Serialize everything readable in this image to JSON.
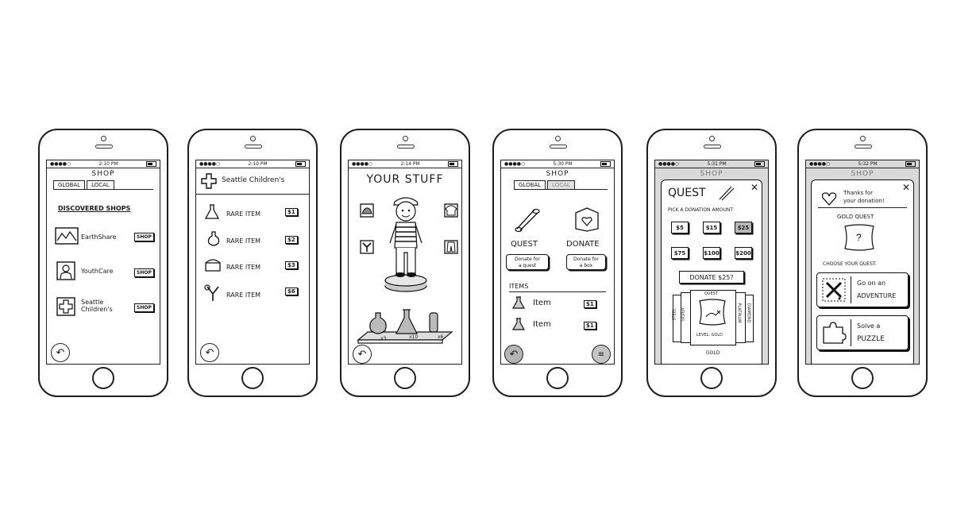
{
  "phone1": {
    "time": "2:10 PM",
    "title": "SHOP",
    "tabs": [
      "GLOBAL",
      "LOCAL"
    ],
    "section": "DISCOVERED SHOPS",
    "shops": [
      {
        "name": "EarthShare",
        "icon": "mountain-icon"
      },
      {
        "name": "YouthCare",
        "icon": "person-icon"
      },
      {
        "name": "Seattle Children's",
        "icon": "cross-icon"
      }
    ],
    "shop_label": "SHOP"
  },
  "phone2": {
    "time": "2:10 PM",
    "title": "Seattle Children's",
    "items": [
      {
        "label": "RARE ITEM",
        "price": "$1",
        "icon": "flask-icon"
      },
      {
        "label": "RARE ITEM",
        "price": "$2",
        "icon": "potion-icon"
      },
      {
        "label": "RARE ITEM",
        "price": "$3",
        "icon": "chest-icon"
      },
      {
        "label": "RARE ITEM",
        "price": "$6",
        "icon": "slingshot-icon"
      }
    ]
  },
  "phone3": {
    "time": "2:14 PM",
    "title": "YOUR STUFF",
    "counts": [
      "x3",
      "x10",
      "x6"
    ]
  },
  "phone4": {
    "time": "5:30 PM",
    "title": "SHOP",
    "tabs": [
      "GLOBAL",
      "LOCAL"
    ],
    "quest_label": "QUEST",
    "donate_label": "DONATE",
    "quest_btn_line1": "Donate for",
    "quest_btn_line2": "a quest",
    "box_btn_line1": "Donate for",
    "box_btn_line2": "a box",
    "items_header": "ITEMS",
    "items": [
      {
        "label": "Item",
        "price": "$1"
      },
      {
        "label": "Item",
        "price": "$1"
      }
    ]
  },
  "phone5": {
    "time": "5:31 PM",
    "title": "SHOP",
    "modal_title": "QUEST",
    "prompt": "PICK A DONATION AMOUNT",
    "amounts": [
      "$5",
      "$15",
      "$25",
      "$75",
      "$100",
      "$200"
    ],
    "selected_amount": "$25",
    "donate_button": "DONATE $25?",
    "card_top": "QUEST",
    "card_left1": "STEEL",
    "card_left2": "SILVER",
    "card_right1": "PLATINUM",
    "card_right2": "DIAMOND",
    "card_level": "LEVEL: GOLD",
    "card_bottom": "GOLD"
  },
  "phone6": {
    "time": "5:32 PM",
    "title": "SHOP",
    "thanks_line1": "Thanks for",
    "thanks_line2": "your donation!",
    "quest_name": "GOLD QUEST",
    "choose": "CHOOSE YOUR QUEST:",
    "option1_line1": "Go on an",
    "option1_line2": "ADVENTURE",
    "option2_line1": "Solve a",
    "option2_line2": "PUZZLE"
  }
}
